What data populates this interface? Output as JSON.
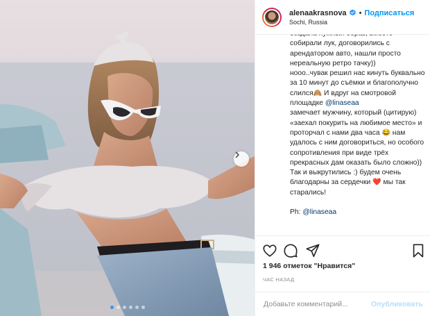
{
  "post": {
    "carousel_dots": 6,
    "active_dot": 0
  },
  "header": {
    "username": "alenaakrasnova",
    "separator": "•",
    "follow_label": "Подписаться",
    "location": "Sochi, Russia"
  },
  "caption": {
    "text_1": "создала нужный образ, вместе собирали лук, договорились с арендатором авто, нашли просто нереальную ретро тачку))\nнооо..чувак решил нас кинуть буквально за 10 минут до съёмки и благополучно слился",
    "emoji_1": "🙈",
    "text_2": " И вдруг на смотровой площадке ",
    "mention_1": "@linaseaa",
    "text_3": "\nзамечает мужчину, который (цитирую) «заехал покурить на любимое место» и проторчал с нами два часа ",
    "emoji_2": "😂",
    "text_4": " нам удалось с ним договориться, но особого сопротивления при виде трёх прекрасных дам оказать было сложно))\nТак и выкрутились :) будем очень благодарны за сердечки ",
    "emoji_3": "❤️",
    "text_5": " мы так старались!\n\nPh: ",
    "mention_2": "@linaseaa"
  },
  "stats": {
    "likes": "1 946 отметок \"Нравится\"",
    "time": "ЧАС НАЗАД"
  },
  "comment": {
    "placeholder": "Добавьте комментарий...",
    "publish_label": "Опубликовать"
  },
  "colors": {
    "accent": "#0095f6",
    "publish_disabled": "#b2dffc",
    "heart": "#ed4956"
  }
}
